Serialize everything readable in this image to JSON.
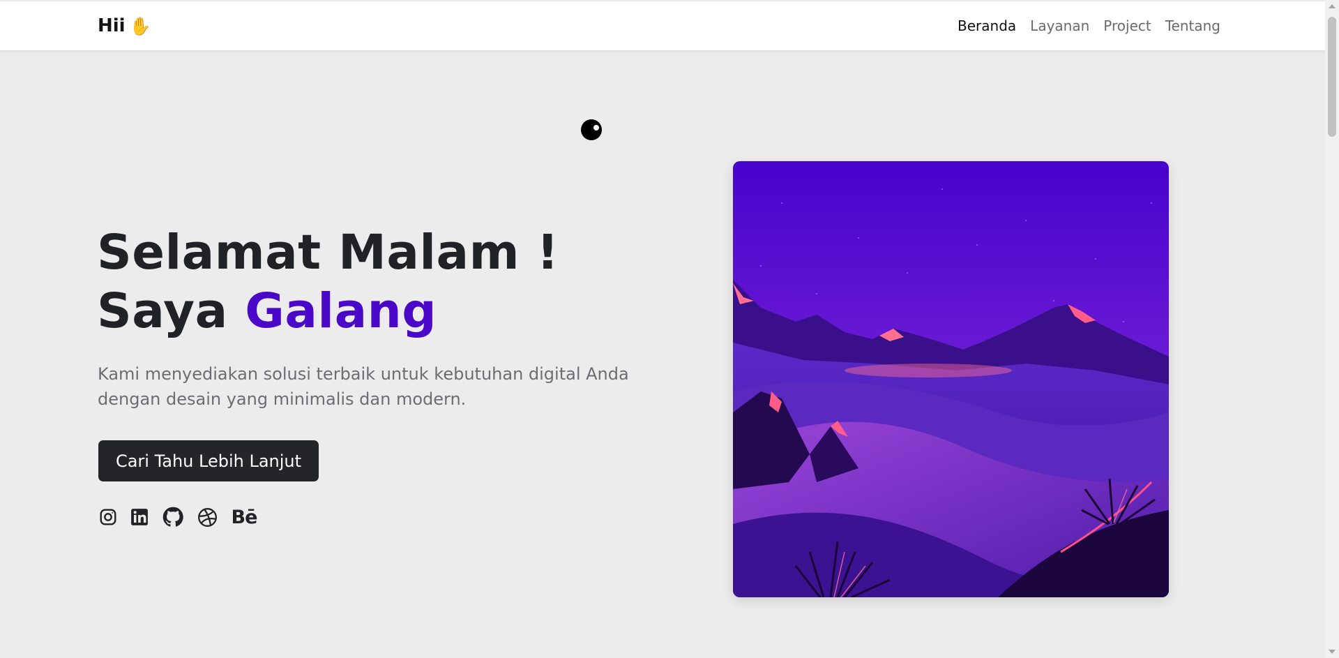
{
  "navbar": {
    "brand_text": "Hii",
    "brand_emoji": "✋",
    "links": [
      {
        "label": "Beranda",
        "active": true
      },
      {
        "label": "Layanan",
        "active": false
      },
      {
        "label": "Project",
        "active": false
      },
      {
        "label": "Tentang",
        "active": false
      }
    ]
  },
  "hero": {
    "greeting": "Selamat Malam !",
    "name_prefix": "Saya",
    "name": "Galang",
    "description": "Kami menyediakan solusi terbaik untuk kebutuhan digital Anda dengan desain yang minimalis dan modern.",
    "cta_label": "Cari Tahu Lebih Lanjut",
    "socials": [
      {
        "icon": "instagram-icon"
      },
      {
        "icon": "linkedin-icon"
      },
      {
        "icon": "github-icon"
      },
      {
        "icon": "dribbble-icon"
      },
      {
        "icon": "behance-icon",
        "text": "Bē"
      }
    ],
    "image": {
      "icon": "night-desert-landscape-illustration"
    }
  },
  "colors": {
    "accent": "#4b08c9",
    "text_dark": "#212227",
    "text_muted": "#6c6c73",
    "page_background": "#ececec",
    "button_background": "#232529"
  }
}
